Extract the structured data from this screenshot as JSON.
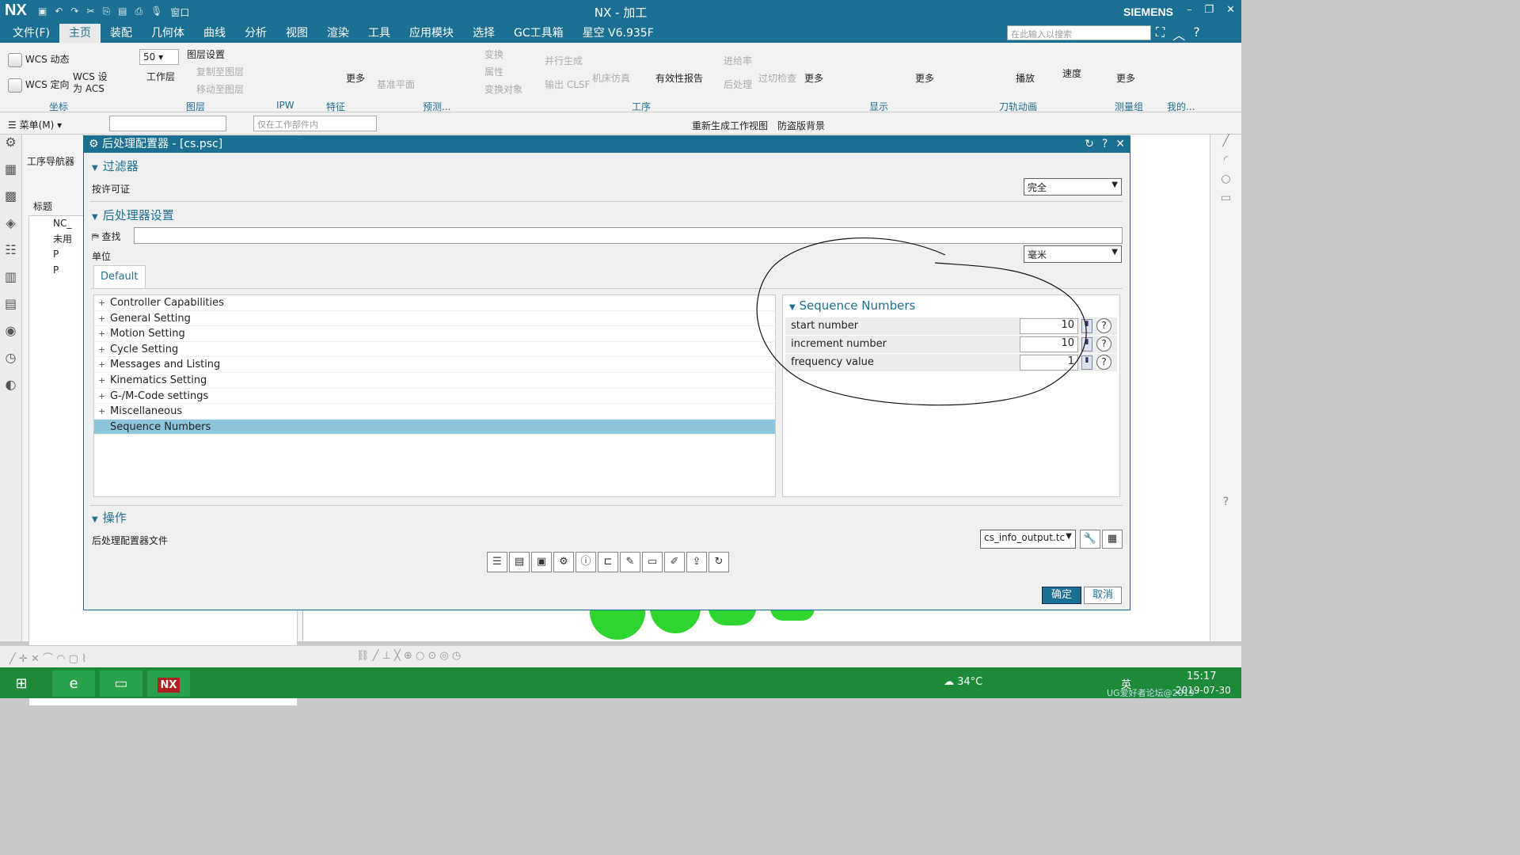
{
  "titlebar": {
    "logo": "NX",
    "title": "NX - 加工",
    "brand": "SIEMENS",
    "window_menu": "窗口",
    "min": "–",
    "restore": "❐",
    "close": "✕"
  },
  "menubar": {
    "items": [
      "文件(F)",
      "主页",
      "装配",
      "几何体",
      "曲线",
      "分析",
      "视图",
      "渲染",
      "工具",
      "应用模块",
      "选择",
      "GC工具箱",
      "星空 V6.935F"
    ],
    "active": "主页",
    "search_placeholder": "在此输入以搜索"
  },
  "ribbon": {
    "wcs_dynamic": "WCS 动态",
    "wcs_orient": "WCS 定向",
    "wcs_acs": "WCS 设为 ACS",
    "layer_value": "50",
    "work_layer": "工作层",
    "layer_settings": "图层设置",
    "copy_to_layer": "复制至图层",
    "move_to_layer": "移动至图层",
    "more1": "更多",
    "datum_plane": "基准平面",
    "transform": "变换",
    "attribute": "属性",
    "transform_obj": "变换对象",
    "parallel_gen": "并行生成",
    "output_clsf": "输出 CLSF",
    "machine_sim": "机床仿真",
    "validity_report": "有效性报告",
    "feed_rate": "进给率",
    "post_process": "后处理",
    "gouge_check": "过切检查",
    "more2": "更多",
    "more3": "更多",
    "play": "播放",
    "speed": "速度",
    "more4": "更多",
    "groups": {
      "coords": "坐标",
      "layer": "图层",
      "ipw": "IPW",
      "feature": "特征",
      "preview": "预测...",
      "operation": "工序",
      "display": "显示",
      "toolpath_anim": "刀轨动画",
      "measure": "测量组",
      "mine": "我的..."
    }
  },
  "toolbar2": {
    "menu": "菜单(M)",
    "filter_scope": "仅在工作部件内",
    "regen_view": "重新生成工作视图",
    "anti_piracy_bg": "防盗版背景"
  },
  "navigator": {
    "title": "工序导航器",
    "column": "标题",
    "rows": [
      "NC_",
      "未用",
      "P",
      "P"
    ]
  },
  "dialog": {
    "title": "后处理配置器 - [cs.psc]",
    "filter_section": "过滤器",
    "license_label": "按许可证",
    "license_value": "完全",
    "settings_section": "后处理器设置",
    "find_label": "查找",
    "unit_label": "单位",
    "unit_value": "毫米",
    "tab": "Default",
    "tree": [
      "Controller Capabilities",
      "General Setting",
      "Motion Setting",
      "Cycle Setting",
      "Messages and Listing",
      "Kinematics Setting",
      "G-/M-Code settings",
      "Miscellaneous",
      "Sequence Numbers"
    ],
    "selected": "Sequence Numbers",
    "props": {
      "header": "Sequence Numbers",
      "rows": [
        {
          "label": "start number",
          "value": "10"
        },
        {
          "label": "increment number",
          "value": "10"
        },
        {
          "label": "frequency value",
          "value": "1"
        }
      ]
    },
    "action_section": "操作",
    "config_file_label": "后处理配置器文件",
    "config_file_value": "cs_info_output.tc",
    "ok": "确定",
    "cancel": "取消"
  },
  "taskbar": {
    "temperature": "34°C",
    "time": "15:17",
    "date": "2019-07-30",
    "ime": "英",
    "watermark": "UG爱好者论坛@2019"
  }
}
